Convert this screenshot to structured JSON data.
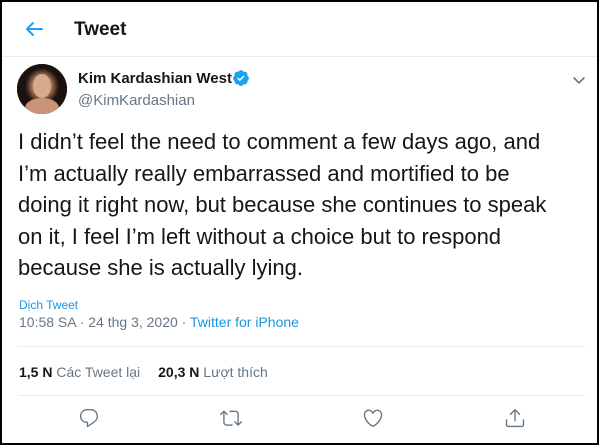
{
  "header": {
    "title": "Tweet",
    "back_icon": "arrow-left-icon"
  },
  "author": {
    "name": "Kim Kardashian West",
    "handle": "@KimKardashian",
    "verified": true,
    "verified_icon": "verified-badge-icon",
    "menu_icon": "chevron-down-icon"
  },
  "tweet": {
    "text": "I didn’t feel the need to comment a few days ago, and\nI’m actually really embarrassed and mortified to be\ndoing it right now, but because she continues to speak\non it, I feel I’m left without a choice but to respond\nbecause she is actually lying.",
    "translate_label": "Dịch Tweet",
    "timestamp": "10:58 SA · 24 thg 3, 2020",
    "separator": " · ",
    "source": "Twitter for iPhone"
  },
  "stats": {
    "retweets_count": "1,5 N",
    "retweets_label": "Các Tweet lại",
    "likes_count": "20,3 N",
    "likes_label": "Lượt thích"
  },
  "actions": [
    {
      "name": "reply",
      "icon": "reply-icon"
    },
    {
      "name": "retweet",
      "icon": "retweet-icon"
    },
    {
      "name": "like",
      "icon": "heart-icon"
    },
    {
      "name": "share",
      "icon": "share-icon"
    }
  ],
  "colors": {
    "accent": "#1da1f2",
    "link": "#1b95e0",
    "text": "#14171a",
    "secondary": "#657786",
    "border": "#e6ecf0"
  }
}
